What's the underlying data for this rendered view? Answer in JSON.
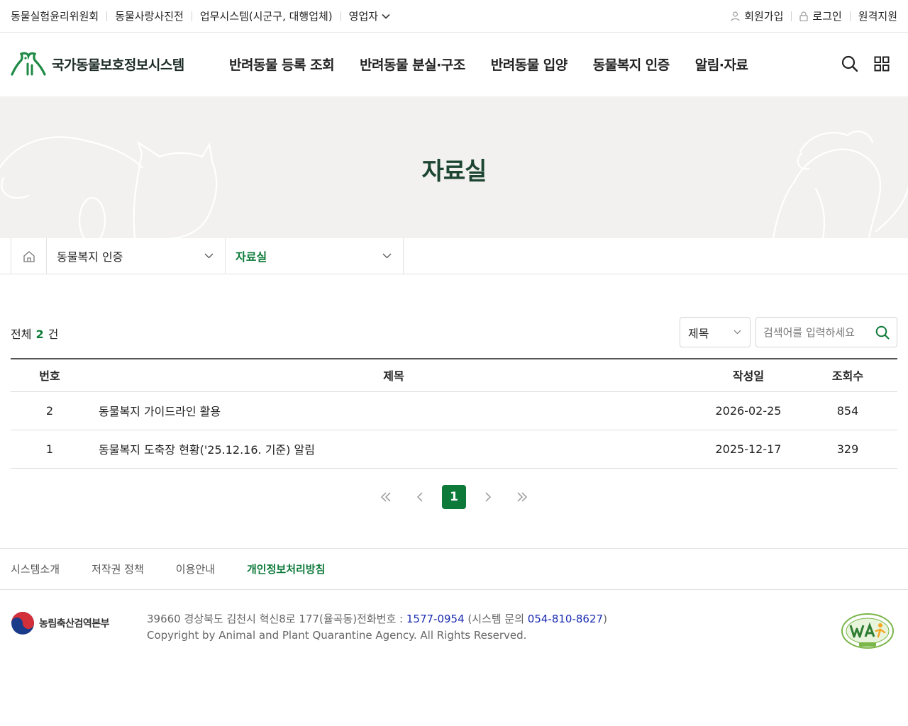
{
  "util": {
    "left": [
      "동물실험윤리위원회",
      "동물사랑사진전",
      "업무시스템(시군구, 대행업체)",
      "영업자"
    ],
    "signup": "회원가입",
    "login": "로그인",
    "remote": "원격지원"
  },
  "header": {
    "logo_text": "국가동물보호정보시스템",
    "nav": [
      "반려동물 등록 조회",
      "반려동물 분실·구조",
      "반려동물 입양",
      "동물복지 인증",
      "알림·자료"
    ]
  },
  "hero": {
    "title": "자료실"
  },
  "location": {
    "depth1": "동물복지 인증",
    "depth2": "자료실"
  },
  "list": {
    "total_prefix": "전체",
    "total_count": "2",
    "total_suffix": "건",
    "search_select": "제목",
    "search_placeholder": "검색어를 입력하세요"
  },
  "table": {
    "headers": [
      "번호",
      "제목",
      "작성일",
      "조회수"
    ],
    "rows": [
      {
        "num": "2",
        "title": "동물복지 가이드라인 활용",
        "date": "2026-02-25",
        "views": "854"
      },
      {
        "num": "1",
        "title": "동물복지 도축장 현황('25.12.16. 기준) 알림",
        "date": "2025-12-17",
        "views": "329"
      }
    ]
  },
  "paging": {
    "current": "1"
  },
  "footer": {
    "links": [
      "시스템소개",
      "저작권 정책",
      "이용안내",
      "개인정보처리방침"
    ],
    "agency": "농림축산검역본부",
    "addr_part1": "39660 경상북도 김천시 혁신8로 177(율곡동)전화번호 : ",
    "tel": "1577-0954",
    "addr_part2": " (시스템 문의 ",
    "tel2": "054-810-8627",
    "addr_part3": ")",
    "copyright": "Copyright by Animal and Plant Quarantine Agency. All Rights Reserved."
  },
  "colors": {
    "primary": "#0d7a3a",
    "hero_bg": "#f2f1ef",
    "hero_title": "#1d4632"
  }
}
